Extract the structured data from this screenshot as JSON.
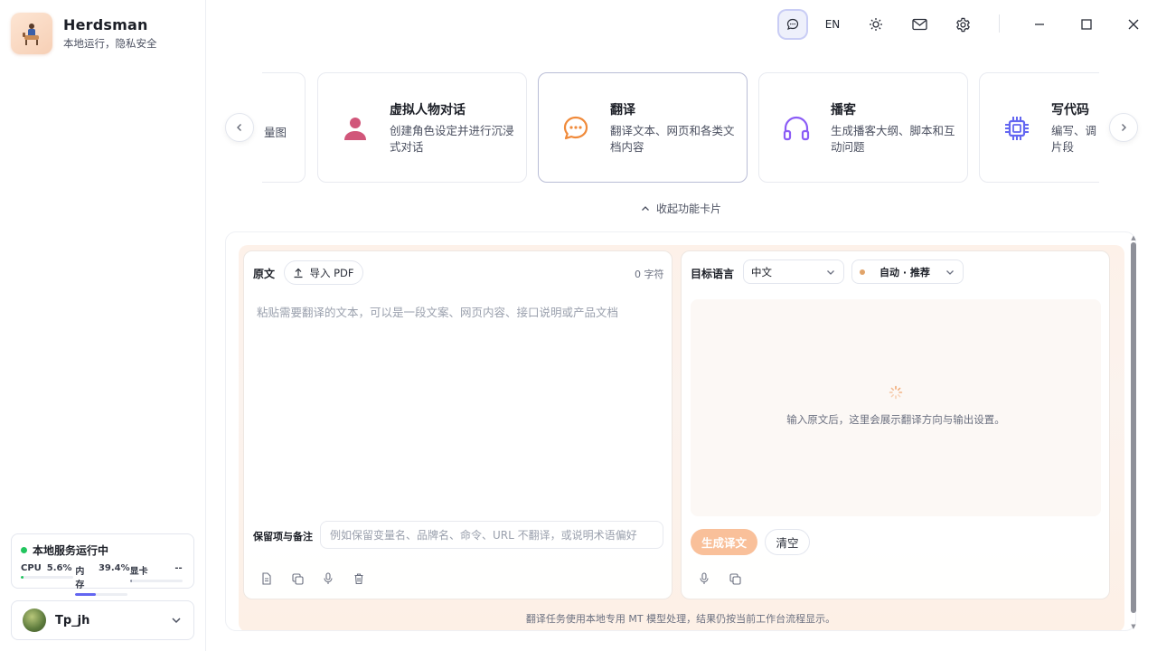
{
  "brand": {
    "title": "Herdsman",
    "subtitle": "本地运行，隐私安全"
  },
  "status": {
    "label": "本地服务运行中",
    "cpu_label": "CPU",
    "cpu_value": "5.6%",
    "cpu_fraction": 0.056,
    "mem_label": "内存",
    "mem_value": "39.4%",
    "mem_fraction": 0.394,
    "gpu_label": "显卡",
    "gpu_value": "--"
  },
  "user": {
    "name": "Tp_jh"
  },
  "topbar": {
    "lang_label": "EN"
  },
  "cards": {
    "partial_left_desc": "量图",
    "items": [
      {
        "title": "虚拟人物对话",
        "desc": "创建角色设定并进行沉浸式对话",
        "icon": "person-icon",
        "color": "#d1567a"
      },
      {
        "title": "翻译",
        "desc": "翻译文本、网页和各类文档内容",
        "icon": "chat-bubble-icon",
        "color": "#f08a3a"
      },
      {
        "title": "播客",
        "desc": "生成播客大纲、脚本和互动问题",
        "icon": "headphones-icon",
        "color": "#8b5cf6"
      },
      {
        "title": "写代码",
        "desc": "编写、调片段",
        "icon": "chip-icon",
        "color": "#6366f1"
      }
    ],
    "collapse_label": "收起功能卡片"
  },
  "source": {
    "label": "原文",
    "import_label": "导入 PDF",
    "char_count": "0 字符",
    "placeholder": "粘贴需要翻译的文本，可以是一段文案、网页内容、接口说明或产品文档",
    "notes_label": "保留项与备注",
    "notes_placeholder": "例如保留变量名、品牌名、命令、URL 不翻译，或说明术语偏好"
  },
  "target": {
    "label": "目标语言",
    "language": "中文",
    "mode": "自动 · 推荐",
    "empty_hint": "输入原文后，这里会展示翻译方向与输出设置。",
    "generate_label": "生成译文",
    "clear_label": "清空"
  },
  "footer_note": "翻译任务使用本地专用 MT 模型处理，结果仍按当前工作台流程显示。"
}
